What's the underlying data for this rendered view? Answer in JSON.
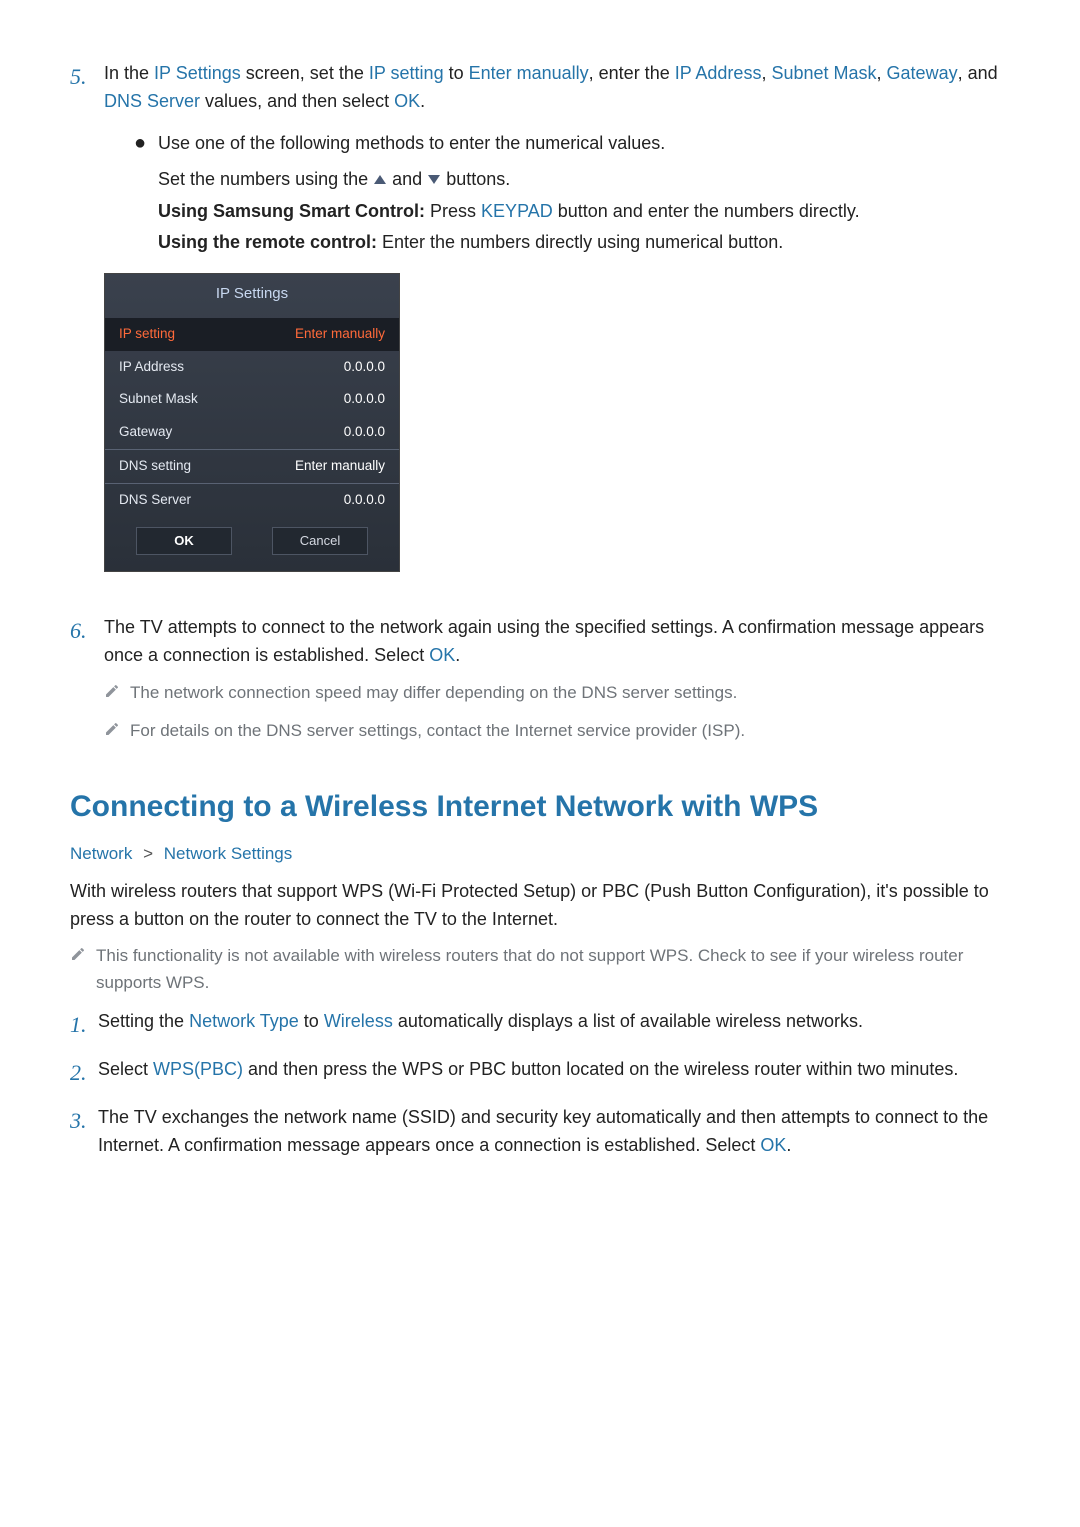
{
  "steps": {
    "s5": {
      "num": "5.",
      "text_parts": {
        "t1": "In the ",
        "k1": "IP Settings",
        "t2": " screen, set the ",
        "k2": "IP setting",
        "t3": " to ",
        "k3": "Enter manually",
        "t4": ", enter the ",
        "k4": "IP Address",
        "t5": ", ",
        "k5": "Subnet Mask",
        "t6": ", ",
        "k6": "Gateway",
        "t7": ", and ",
        "k7": "DNS Server",
        "t8": " values, and then select ",
        "k8": "OK",
        "t9": "."
      },
      "bullet": "Use one of the following methods to enter the numerical values.",
      "sub": {
        "l1a": "Set the numbers using the ",
        "l1b": " and ",
        "l1c": " buttons.",
        "l2a": "Using Samsung Smart Control:",
        "l2b": " Press ",
        "l2c": "KEYPAD",
        "l2d": " button and enter the numbers directly.",
        "l3a": "Using the remote control:",
        "l3b": " Enter the numbers directly using numerical button."
      }
    },
    "s6": {
      "num": "6.",
      "t1": "The TV attempts to connect to the network again using the specified settings. A confirmation message appears once a connection is established. Select ",
      "k1": "OK",
      "t2": ".",
      "notes": {
        "n1": "The network connection speed may differ depending on the DNS server settings.",
        "n2": "For details on the DNS server settings, contact the Internet service provider (ISP)."
      }
    }
  },
  "panel": {
    "title": "IP Settings",
    "rows": {
      "ip_setting": {
        "label": "IP setting",
        "value": "Enter manually"
      },
      "ip_address": {
        "label": "IP Address",
        "value": "0.0.0.0"
      },
      "subnet_mask": {
        "label": "Subnet Mask",
        "value": "0.0.0.0"
      },
      "gateway": {
        "label": "Gateway",
        "value": "0.0.0.0"
      },
      "dns_setting": {
        "label": "DNS setting",
        "value": "Enter manually"
      },
      "dns_server": {
        "label": "DNS Server",
        "value": "0.0.0.0"
      }
    },
    "buttons": {
      "ok": "OK",
      "cancel": "Cancel"
    }
  },
  "wps": {
    "heading": "Connecting to a Wireless Internet Network with WPS",
    "breadcrumb": {
      "a": "Network",
      "sep": ">",
      "b": "Network Settings"
    },
    "intro": "With wireless routers that support WPS (Wi-Fi Protected Setup) or PBC (Push Button Configuration), it's possible to press a button on the router to connect the TV to the Internet.",
    "note": "This functionality is not available with wireless routers that do not support WPS. Check to see if your wireless router supports WPS.",
    "steps": {
      "s1": {
        "num": "1.",
        "t1": "Setting the ",
        "k1": "Network Type",
        "t2": " to ",
        "k2": "Wireless",
        "t3": " automatically displays a list of available wireless networks."
      },
      "s2": {
        "num": "2.",
        "t1": "Select ",
        "k1": "WPS(PBC)",
        "t2": " and then press the WPS or PBC button located on the wireless router within two minutes."
      },
      "s3": {
        "num": "3.",
        "t1": "The TV exchanges the network name (SSID) and security key automatically and then attempts to connect to the Internet. A confirmation message appears once a connection is established. Select ",
        "k1": "OK",
        "t2": "."
      }
    }
  }
}
